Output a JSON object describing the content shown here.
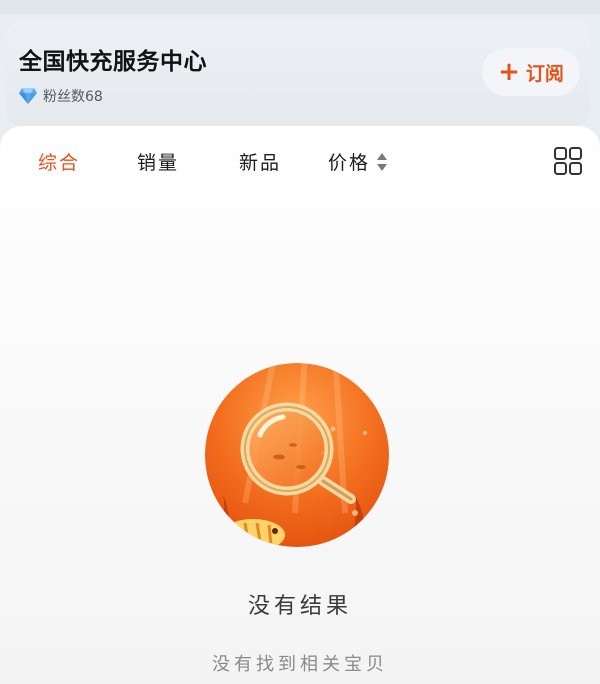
{
  "shop": {
    "name": "全国快充服务中心",
    "fans_label": "粉丝数68",
    "icon": "diamond-icon"
  },
  "subscribe": {
    "plus": "+",
    "label": "订阅"
  },
  "tabs": [
    {
      "label": "综合",
      "active": true
    },
    {
      "label": "销量",
      "active": false
    },
    {
      "label": "新品",
      "active": false
    },
    {
      "label": "价格",
      "active": false
    }
  ],
  "empty_state": {
    "title": "没有结果",
    "subtitle": "没有找到相关宝贝",
    "icon": "magnifier-illustration"
  },
  "colors": {
    "accent": "#e3541a",
    "text_primary": "#121212",
    "text_secondary": "#8a8a8a"
  }
}
